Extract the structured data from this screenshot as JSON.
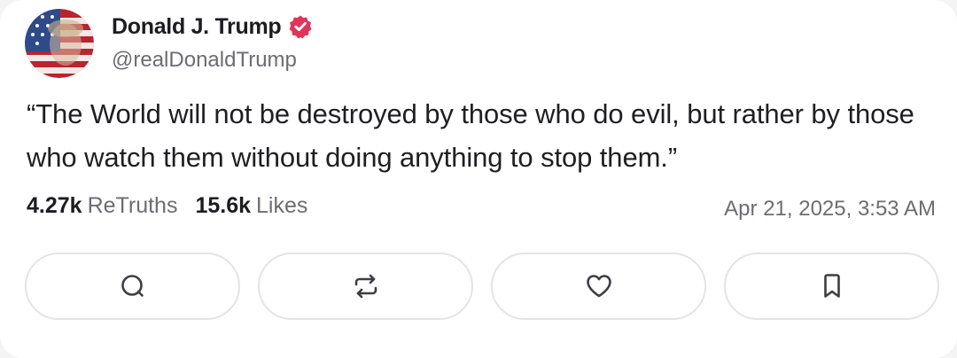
{
  "author": {
    "name": "Donald J. Trump",
    "handle": "@realDonaldTrump",
    "verified_color": "#e0355b"
  },
  "post": {
    "text": "“The World will not be destroyed by those who do evil, but rather by those who watch them without doing anything to stop them.”"
  },
  "stats": {
    "retruths_count": "4.27k",
    "retruths_label": "ReTruths",
    "likes_count": "15.6k",
    "likes_label": "Likes"
  },
  "timestamp": "Apr 21, 2025, 3:53 AM",
  "actions": [
    {
      "icon": "comment-icon"
    },
    {
      "icon": "retruth-icon"
    },
    {
      "icon": "heart-icon"
    },
    {
      "icon": "bookmark-icon"
    }
  ]
}
